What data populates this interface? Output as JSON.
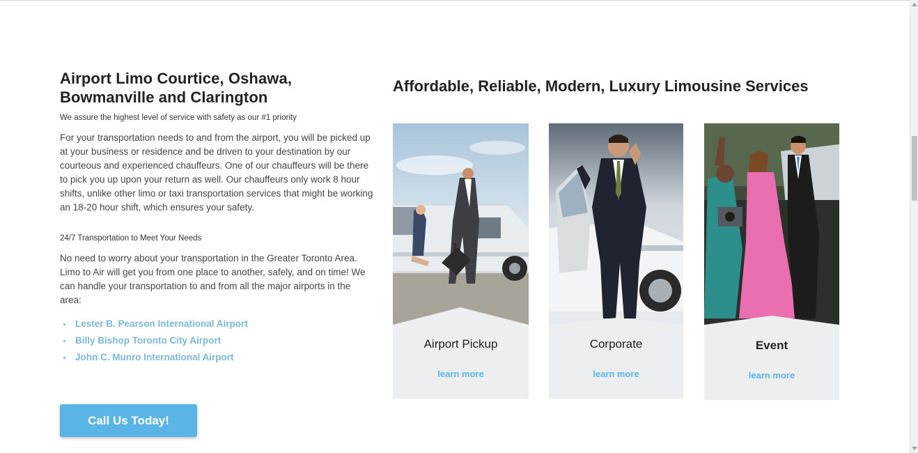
{
  "left": {
    "title_line1": "Airport Limo Courtice, Oshawa,",
    "title_line2": "Bowmanville and Clarington",
    "tagline": "We assure the highest level of service with safety as our #1 priority",
    "paragraph1": "For your transportation needs to and from the airport, you will be picked up at your business or residence and be driven to your destination by our courteous and experienced chauffeurs. One of our chauffeurs will be there to pick you up upon your return as well. Our chauffeurs only work 8 hour shifts, unlike other limo or taxi transportation services that might be working an 18-20 hour shift, which ensures your safety.",
    "subheading": "24/7 Transportation to Meet Your Needs",
    "paragraph2": "No need to worry about your transportation in the Greater Toronto Area. Limo to Air will get you from one place to another, safely, and on time! We can handle your transportation to and from all the major airports in the area:",
    "airports": [
      "Lester B. Pearson International Airport",
      "Billy Bishop Toronto City Airport",
      "John C. Munro International Airport"
    ],
    "cta_label": "Call Us Today!"
  },
  "services": {
    "title": "Affordable, Reliable, Modern, Luxury Limousine Services",
    "cards": [
      {
        "title": "Airport Pickup",
        "link": "learn more"
      },
      {
        "title": "Corporate",
        "link": "learn more"
      },
      {
        "title": "Event",
        "link": "learn more"
      }
    ]
  },
  "colors": {
    "accent": "#5ab4e5",
    "list_link": "#7cb8d6",
    "card_bg": "#eceeef",
    "heading": "#222222"
  }
}
